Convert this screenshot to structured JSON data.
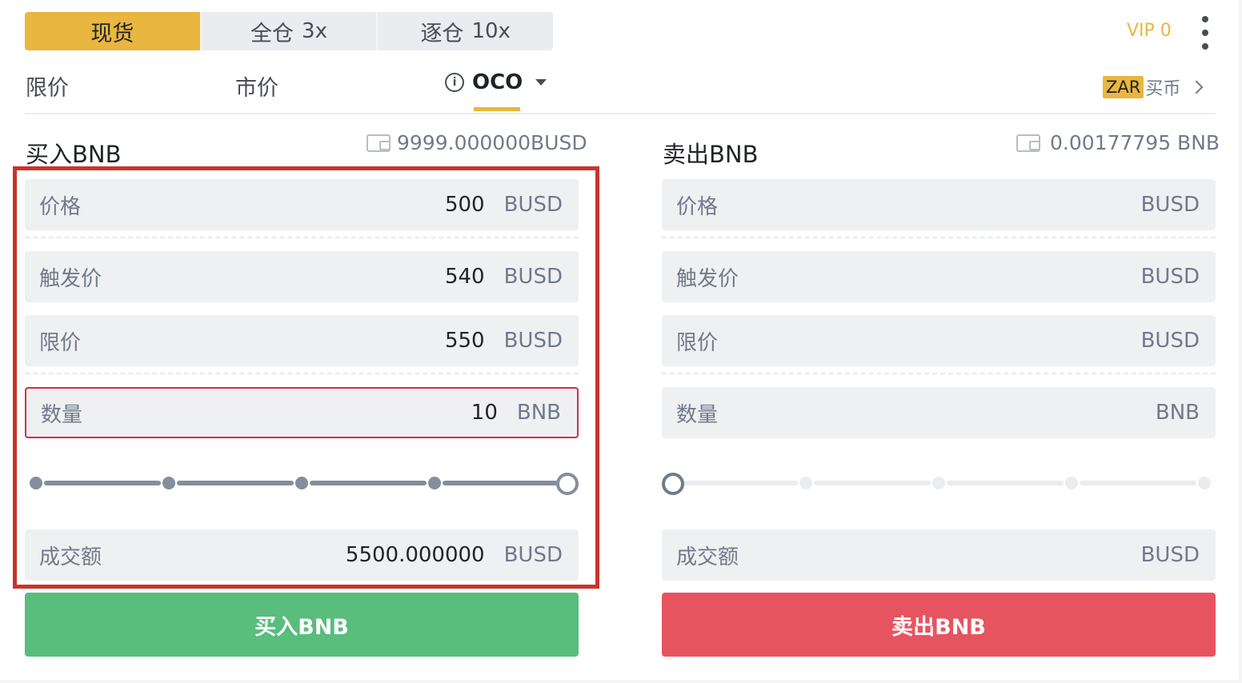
{
  "mode_tabs": [
    {
      "label": "现货",
      "leverage": ""
    },
    {
      "label": "全仓",
      "leverage": "3x"
    },
    {
      "label": "逐仓",
      "leverage": "10x"
    }
  ],
  "vip_label": "VIP 0",
  "order_types": {
    "limit": "限价",
    "market": "市价",
    "oco": "OCO"
  },
  "zar": {
    "badge": "ZAR",
    "label": "买币"
  },
  "buy_panel": {
    "title": "买入BNB",
    "balance": "9999.000000BUSD",
    "price": {
      "label": "价格",
      "value": "500",
      "unit": "BUSD"
    },
    "stop": {
      "label": "触发价",
      "value": "540",
      "unit": "BUSD"
    },
    "limit": {
      "label": "限价",
      "value": "550",
      "unit": "BUSD"
    },
    "amount": {
      "label": "数量",
      "value": "10",
      "unit": "BNB"
    },
    "slider_percent": 100,
    "total": {
      "label": "成交额",
      "value": "5500.000000",
      "unit": "BUSD"
    },
    "button": "买入BNB"
  },
  "sell_panel": {
    "title": "卖出BNB",
    "balance": "0.00177795 BNB",
    "price": {
      "label": "价格",
      "value": "",
      "unit": "BUSD"
    },
    "stop": {
      "label": "触发价",
      "value": "",
      "unit": "BUSD"
    },
    "limit": {
      "label": "限价",
      "value": "",
      "unit": "BUSD"
    },
    "amount": {
      "label": "数量",
      "value": "",
      "unit": "BNB"
    },
    "slider_percent": 0,
    "total": {
      "label": "成交额",
      "value": "",
      "unit": "BUSD"
    },
    "button": "卖出BNB"
  },
  "colors": {
    "accent": "#e9b73f",
    "buy": "#58bd7d",
    "sell": "#e65460",
    "highlight": "#c8332c"
  }
}
